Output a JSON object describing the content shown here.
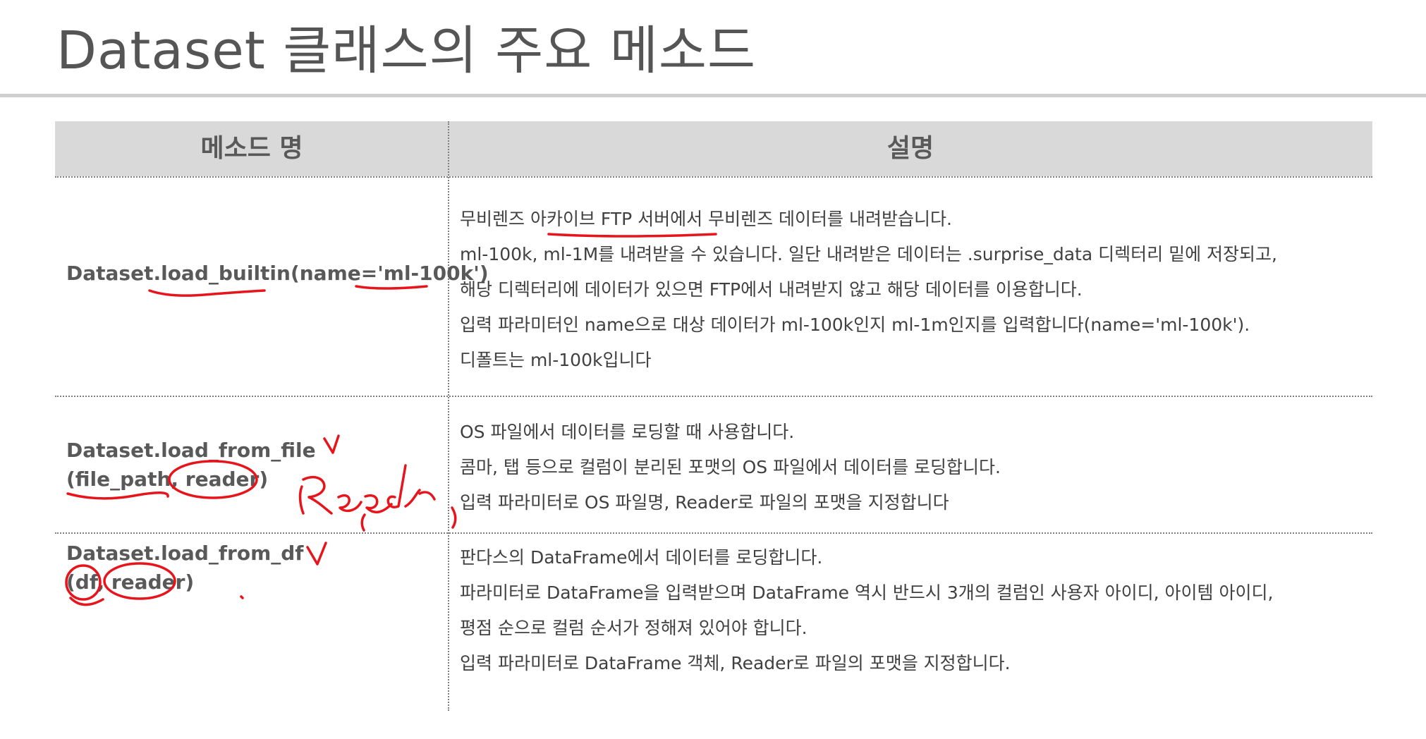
{
  "slide": {
    "title": "Dataset 클래스의 주요 메소드"
  },
  "table": {
    "headers": {
      "method": "메소드 명",
      "description": "설명"
    },
    "rows": [
      {
        "method_line1": "Dataset.load_builtin(name='ml-100k')",
        "method_line2": "",
        "description": [
          "무비렌즈 아카이브 FTP 서버에서 무비렌즈 데이터를 내려받습니다.",
          "ml-100k, ml-1M를 내려받을 수 있습니다. 일단 내려받은 데이터는 .surprise_data 디렉터리 밑에 저장되고,",
          "해당 디렉터리에 데이터가 있으면 FTP에서 내려받지 않고 해당 데이터를 이용합니다.",
          "입력 파라미터인 name으로 대상 데이터가 ml-100k인지 ml-1m인지를 입력합니다(name='ml-100k').",
          "디폴트는 ml-100k입니다"
        ]
      },
      {
        "method_line1": "Dataset.load_from_file",
        "method_line2": "(file_path, reader)",
        "description": [
          "OS 파일에서 데이터를 로딩할 때 사용합니다.",
          "콤마, 탭 등으로 컬럼이 분리된 포맷의 OS 파일에서 데이터를 로딩합니다.",
          "입력 파라미터로 OS 파일명, Reader로 파일의 포맷을 지정합니다"
        ]
      },
      {
        "method_line1": "Dataset.load_from_df",
        "method_line2": "(df, reader)",
        "description": [
          "판다스의 DataFrame에서 데이터를 로딩합니다.",
          "파라미터로 DataFrame을 입력받으며 DataFrame 역시 반드시 3개의 컬럼인 사용자 아이디, 아이템 아이디,",
          "평점 순으로 컬럼 순서가 정해져 있어야 합니다.",
          "입력 파라미터로 DataFrame 객체, Reader로 파일의 포맷을 지정합니다."
        ]
      }
    ]
  },
  "annotations": {
    "ink_color": "#e8141b"
  }
}
